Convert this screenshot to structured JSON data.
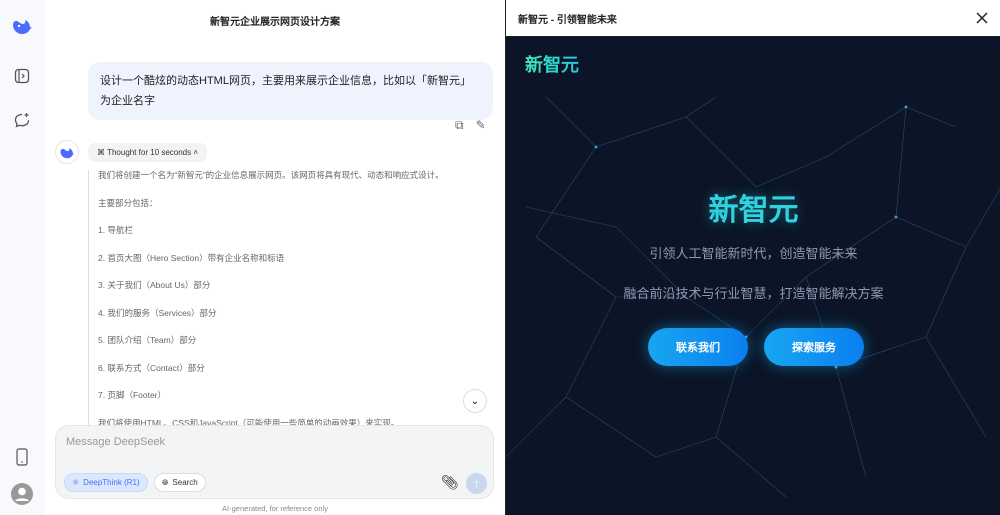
{
  "sidebar": {
    "icons": [
      "deepseek-logo",
      "toggle-sidebar-icon",
      "new-chat-icon",
      "mobile-app-icon",
      "user-avatar"
    ]
  },
  "chat": {
    "title": "新智元企业展示网页设计方案",
    "user_message": "设计一个酷炫的动态HTML网页，主要用来展示企业信息，比如以「新智元」为企业名字",
    "thought_label": "Thought for 10 seconds",
    "thinking": [
      "我们将创建一个名为“新智元”的企业信息展示网页。该网页将具有现代、动态和响应式设计。",
      "主要部分包括：",
      "1. 导航栏",
      "2. 首页大图（Hero Section）带有企业名称和标语",
      "3. 关于我们（About Us）部分",
      "4. 我们的服务（Services）部分",
      "5. 团队介绍（Team）部分",
      "6. 联系方式（Contact）部分",
      "7. 页脚（Footer）",
      "我们将使用HTML、CSS和JavaScript（可能使用一些简单的动画效果）来实现。"
    ],
    "input_placeholder": "Message DeepSeek",
    "deepthink_label": "DeepThink (R1)",
    "search_label": "Search",
    "footer": "AI-generated, for reference only"
  },
  "preview": {
    "title": "新智元 - 引领智能未来",
    "logo": "新智元",
    "hero_title": "新智元",
    "subtitle1": "引领人工智能新时代，创造智能未来",
    "subtitle2": "融合前沿技术与行业智慧，打造智能解决方案",
    "btn_contact": "联系我们",
    "btn_services": "探索服务"
  },
  "colors": {
    "accent": "#4d6bfe",
    "preview_bg": "#0b1527",
    "hero": "#2fd3e0",
    "button": "#18a6f0"
  }
}
